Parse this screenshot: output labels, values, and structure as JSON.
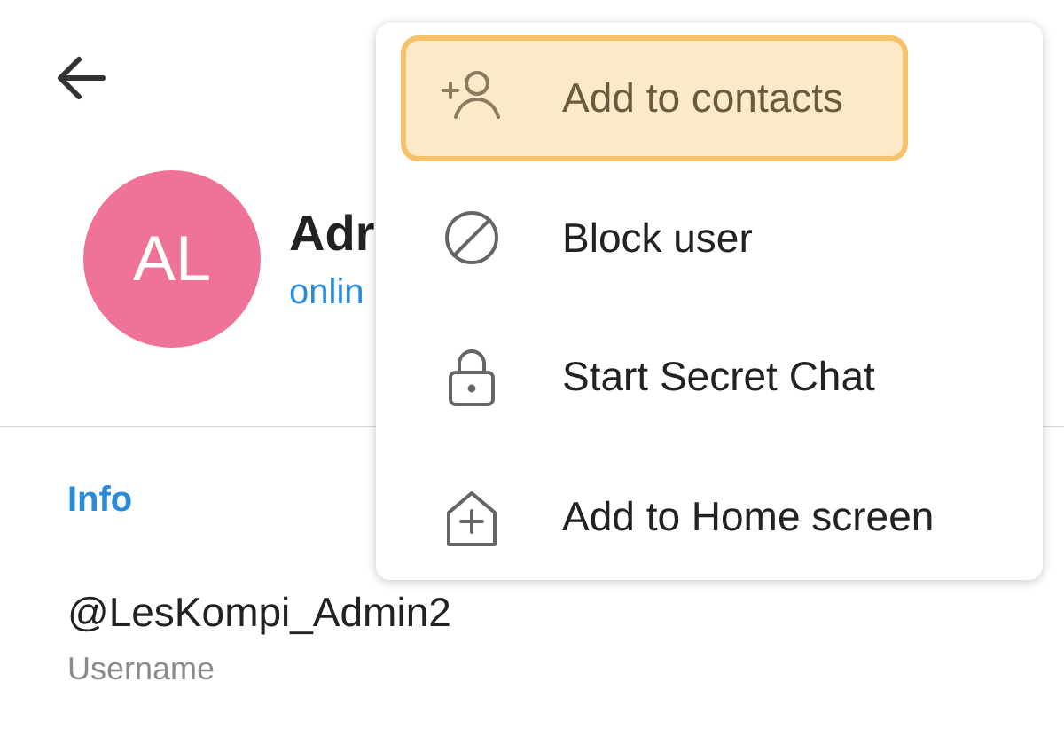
{
  "profile": {
    "avatar_initials": "AL",
    "name": "Adr",
    "status": "onlin"
  },
  "info": {
    "heading": "Info",
    "username": "@LesKompi_Admin2",
    "username_label": "Username"
  },
  "menu": {
    "items": [
      {
        "kind": "add-contact",
        "label": "Add to contacts",
        "selected": true
      },
      {
        "kind": "block",
        "label": "Block user",
        "selected": false
      },
      {
        "kind": "lock",
        "label": "Start Secret Chat",
        "selected": false
      },
      {
        "kind": "home-add",
        "label": "Add to Home screen",
        "selected": false
      }
    ]
  }
}
